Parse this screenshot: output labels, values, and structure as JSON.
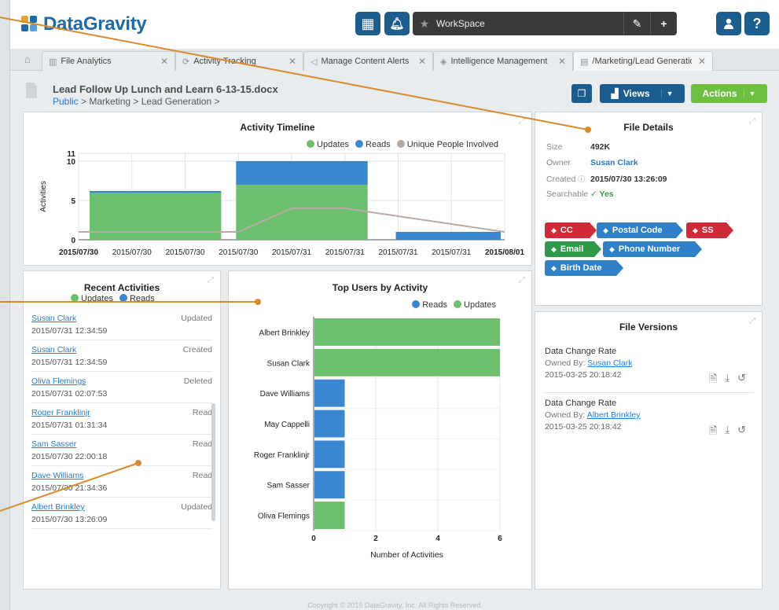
{
  "app": {
    "logo": "DataGravity",
    "workspace_label": "WorkSpace",
    "copyright": "Copyright © 2015 DataGravity, Inc. All Rights Reserved."
  },
  "header_icons": [
    "grid-icon",
    "bell-icon",
    "star-icon",
    "pencil-icon",
    "plus-icon",
    "user-icon",
    "help-icon"
  ],
  "tabs": [
    {
      "label": "File Analytics",
      "icon": "chart-icon"
    },
    {
      "label": "Activity Tracking",
      "icon": "activity-icon"
    },
    {
      "label": "Manage Content Alerts",
      "icon": "alert-icon"
    },
    {
      "label": "Intelligence Management",
      "icon": "tag-icon"
    },
    {
      "label": "/Marketing/Lead Generation",
      "icon": "file-icon",
      "active": true
    }
  ],
  "file": {
    "title": "Lead Follow Up Lunch and Learn 6-13-15.docx",
    "breadcrumb_link": "Public",
    "breadcrumb_rest": " > Marketing > Lead Generation >"
  },
  "toolbar": {
    "views_label": "Views",
    "actions_label": "Actions"
  },
  "colors": {
    "updates": "#6cbf6c",
    "reads": "#3a87cf",
    "unique": "#b8aaa5",
    "brand": "#1f6aa8",
    "actions": "#6cbf3f"
  },
  "file_details": {
    "title": "File Details",
    "rows": [
      {
        "key": "Size",
        "value": "492K"
      },
      {
        "key": "Owner",
        "value": "Susan Clark"
      },
      {
        "key": "Created",
        "value": "2015/07/30 13:26:09"
      },
      {
        "key": "Searchable",
        "value": "Yes"
      }
    ],
    "tags": [
      {
        "label": "CC",
        "color": "#cf2a35"
      },
      {
        "label": "Postal Code",
        "color": "#2f7fc9"
      },
      {
        "label": "SS",
        "color": "#cf2a35"
      },
      {
        "label": "Email",
        "color": "#2f9a4a"
      },
      {
        "label": "Phone Number",
        "color": "#2f7fc9"
      },
      {
        "label": "Birth Date",
        "color": "#2f7fc9"
      }
    ]
  },
  "recent_activities": {
    "title": "Recent Activities",
    "legend": [
      "Updates",
      "Reads"
    ],
    "items": [
      {
        "user": "Susan Clark",
        "time": "2015/07/31 12:34:59",
        "action": "Updated"
      },
      {
        "user": "Susan Clark",
        "time": "2015/07/31 12:34:59",
        "action": "Created"
      },
      {
        "user": "Oliva Flemings",
        "time": "2015/07/31 02:07:53",
        "action": "Deleted"
      },
      {
        "user": "Roger Franklinjr",
        "time": "2015/07/31 01:31:34",
        "action": "Read"
      },
      {
        "user": "Sam Sasser",
        "time": "2015/07/30 22:00:18",
        "action": "Read"
      },
      {
        "user": "Dave Williams",
        "time": "2015/07/30 21:34:36",
        "action": "Read"
      },
      {
        "user": "Albert Brinkley",
        "time": "2015/07/30 13:26:09",
        "action": "Updated"
      }
    ]
  },
  "file_versions": {
    "title": "File Versions",
    "items": [
      {
        "title": "Data Change Rate",
        "owned_by_label": "Owned By:",
        "owner": "Susan Clark",
        "date": "2015-03-25 20:18:42"
      },
      {
        "title": "Data Change Rate",
        "owned_by_label": "Owned By:",
        "owner": "Albert Brinkley",
        "date": "2015-03-25 20:18:42"
      }
    ]
  },
  "chart_data": [
    {
      "type": "bar",
      "title": "Activity Timeline",
      "ylabel": "Activities",
      "ylim": [
        0,
        11
      ],
      "yticks": [
        0,
        5,
        10,
        11
      ],
      "x_tick_labels": [
        "2015/07/30",
        "2015/07/30",
        "2015/07/30",
        "2015/07/30",
        "2015/07/31",
        "2015/07/31",
        "2015/07/31",
        "2015/07/31",
        "2015/08/01"
      ],
      "legend": [
        "Updates",
        "Reads",
        "Unique People Involved"
      ],
      "legend_position": "top-right",
      "grid": true,
      "bars": [
        {
          "label": "2015/07/30",
          "updates": 6,
          "reads": 0.2
        },
        {
          "label": "2015/07/30",
          "updates": 7,
          "reads": 3
        },
        {
          "label": "2015/07/31",
          "updates": 0,
          "reads": 1
        }
      ],
      "unique_people": [
        1,
        1,
        1,
        1,
        4,
        4,
        3,
        2,
        1
      ]
    },
    {
      "type": "bar",
      "orientation": "horizontal",
      "title": "Top Users by Activity",
      "xlabel": "Number of Activities",
      "xlim": [
        0,
        6
      ],
      "xticks": [
        0,
        2,
        4,
        6
      ],
      "legend": [
        "Reads",
        "Updates"
      ],
      "legend_position": "top-right",
      "grid": true,
      "categories": [
        "Albert Brinkley",
        "Susan Clark",
        "Dave Williams",
        "May Cappelli",
        "Roger Franklinjr",
        "Sam Sasser",
        "Oliva Flemings"
      ],
      "series": [
        {
          "name": "Updates",
          "values": [
            6,
            6,
            0,
            0,
            0,
            0,
            1
          ]
        },
        {
          "name": "Reads",
          "values": [
            0,
            0,
            1,
            1,
            1,
            1,
            0
          ]
        }
      ]
    }
  ]
}
